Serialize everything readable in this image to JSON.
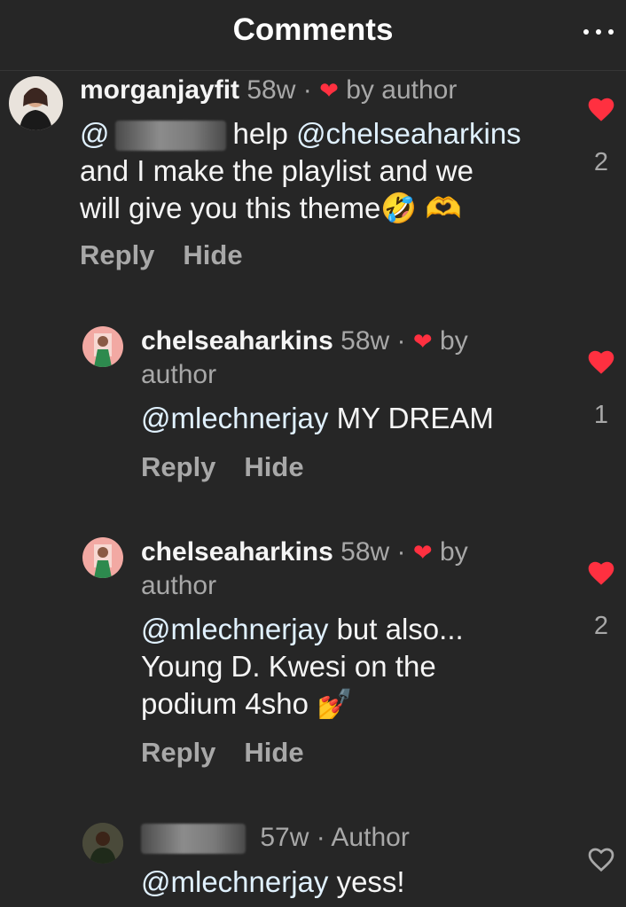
{
  "header": {
    "title": "Comments",
    "more_icon": "more-horizontal-icon"
  },
  "colors": {
    "background": "#262626",
    "like_red": "#ff3040",
    "muted": "#a8a8a8"
  },
  "comments": [
    {
      "username": "morganjayfit",
      "time": "58w",
      "separator": "·",
      "badge": "by author",
      "mention_prefix": "@",
      "body_line1_rest": "help",
      "body_line1_mention": "@chelseaharkins",
      "body_line2": "and I make the playlist and we",
      "body_line3": "will give you this theme",
      "emoji": "🤣 🫶",
      "reply": "Reply",
      "hide": "Hide",
      "likes": "2"
    },
    {
      "username": "chelseaharkins",
      "time": "58w",
      "separator": "·",
      "badge_by": "by",
      "badge_author": "author",
      "mention": "@mlechnerjay",
      "body": "MY DREAM",
      "reply": "Reply",
      "hide": "Hide",
      "likes": "1"
    },
    {
      "username": "chelseaharkins",
      "time": "58w",
      "separator": "·",
      "badge_by": "by",
      "badge_author": "author",
      "mention": "@mlechnerjay",
      "body_line1_rest": "but also...",
      "body_line2": "Young D. Kwesi on the",
      "body_line3": "podium 4sho",
      "emoji": "💅",
      "reply": "Reply",
      "hide": "Hide",
      "likes": "2"
    },
    {
      "time": "57w",
      "separator": "·",
      "badge": "Author",
      "mention": "@mlechnerjay",
      "body": "yess!"
    }
  ]
}
